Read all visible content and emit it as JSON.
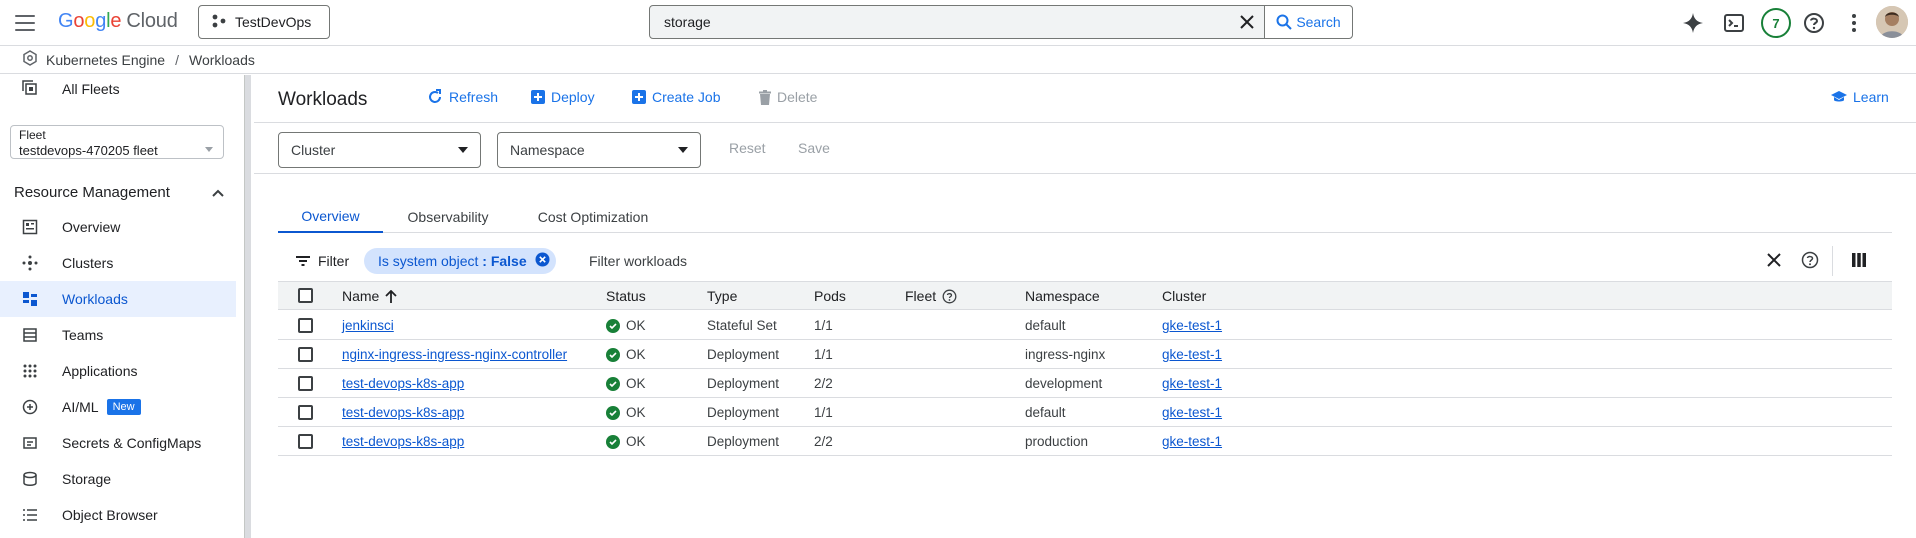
{
  "topbar": {
    "logo_google": [
      "G",
      "o",
      "o",
      "g",
      "l",
      "e"
    ],
    "logo_cloud": "Cloud",
    "project": "TestDevOps",
    "search_value": "storage",
    "search_button": "Search",
    "notifications_count": "7"
  },
  "breadcrumb": {
    "product": "Kubernetes Engine",
    "separator": "/",
    "page": "Workloads"
  },
  "sidebar": {
    "all_fleets": "All Fleets",
    "fleet_label": "Fleet",
    "fleet_value": "testdevops-470205 fleet",
    "section": "Resource Management",
    "items": [
      {
        "label": "Overview",
        "icon": "dashboard-icon"
      },
      {
        "label": "Clusters",
        "icon": "clusters-icon"
      },
      {
        "label": "Workloads",
        "icon": "workloads-icon",
        "active": true
      },
      {
        "label": "Teams",
        "icon": "teams-icon"
      },
      {
        "label": "Applications",
        "icon": "apps-grid-icon"
      },
      {
        "label": "AI/ML",
        "icon": "ai-ml-icon",
        "badge": "New"
      },
      {
        "label": "Secrets & ConfigMaps",
        "icon": "secrets-icon"
      },
      {
        "label": "Storage",
        "icon": "storage-icon"
      },
      {
        "label": "Object Browser",
        "icon": "object-browser-icon"
      }
    ]
  },
  "toolbar": {
    "title": "Workloads",
    "refresh": "Refresh",
    "deploy": "Deploy",
    "create_job": "Create Job",
    "delete": "Delete",
    "learn": "Learn"
  },
  "filters": {
    "cluster_placeholder": "Cluster",
    "namespace_placeholder": "Namespace",
    "reset": "Reset",
    "save": "Save"
  },
  "tabs": [
    "Overview",
    "Observability",
    "Cost Optimization"
  ],
  "filter_row": {
    "filter_label": "Filter",
    "chip_key": "Is system object",
    "chip_sep": " : ",
    "chip_value": "False",
    "placeholder": "Filter workloads"
  },
  "table": {
    "columns": [
      "Name",
      "Status",
      "Type",
      "Pods",
      "Fleet",
      "Namespace",
      "Cluster"
    ],
    "rows": [
      {
        "name": "jenkinsci",
        "status": "OK",
        "type": "Stateful Set",
        "pods": "1/1",
        "fleet": "",
        "namespace": "default",
        "cluster": "gke-test-1"
      },
      {
        "name": "nginx-ingress-ingress-nginx-controller",
        "status": "OK",
        "type": "Deployment",
        "pods": "1/1",
        "fleet": "",
        "namespace": "ingress-nginx",
        "cluster": "gke-test-1"
      },
      {
        "name": "test-devops-k8s-app",
        "status": "OK",
        "type": "Deployment",
        "pods": "2/2",
        "fleet": "",
        "namespace": "development",
        "cluster": "gke-test-1"
      },
      {
        "name": "test-devops-k8s-app",
        "status": "OK",
        "type": "Deployment",
        "pods": "1/1",
        "fleet": "",
        "namespace": "default",
        "cluster": "gke-test-1"
      },
      {
        "name": "test-devops-k8s-app",
        "status": "OK",
        "type": "Deployment",
        "pods": "2/2",
        "fleet": "",
        "namespace": "production",
        "cluster": "gke-test-1"
      }
    ]
  },
  "colors": {
    "accent": "#1a73e8",
    "ok": "#188038",
    "active_bg": "#e8f0fe"
  }
}
